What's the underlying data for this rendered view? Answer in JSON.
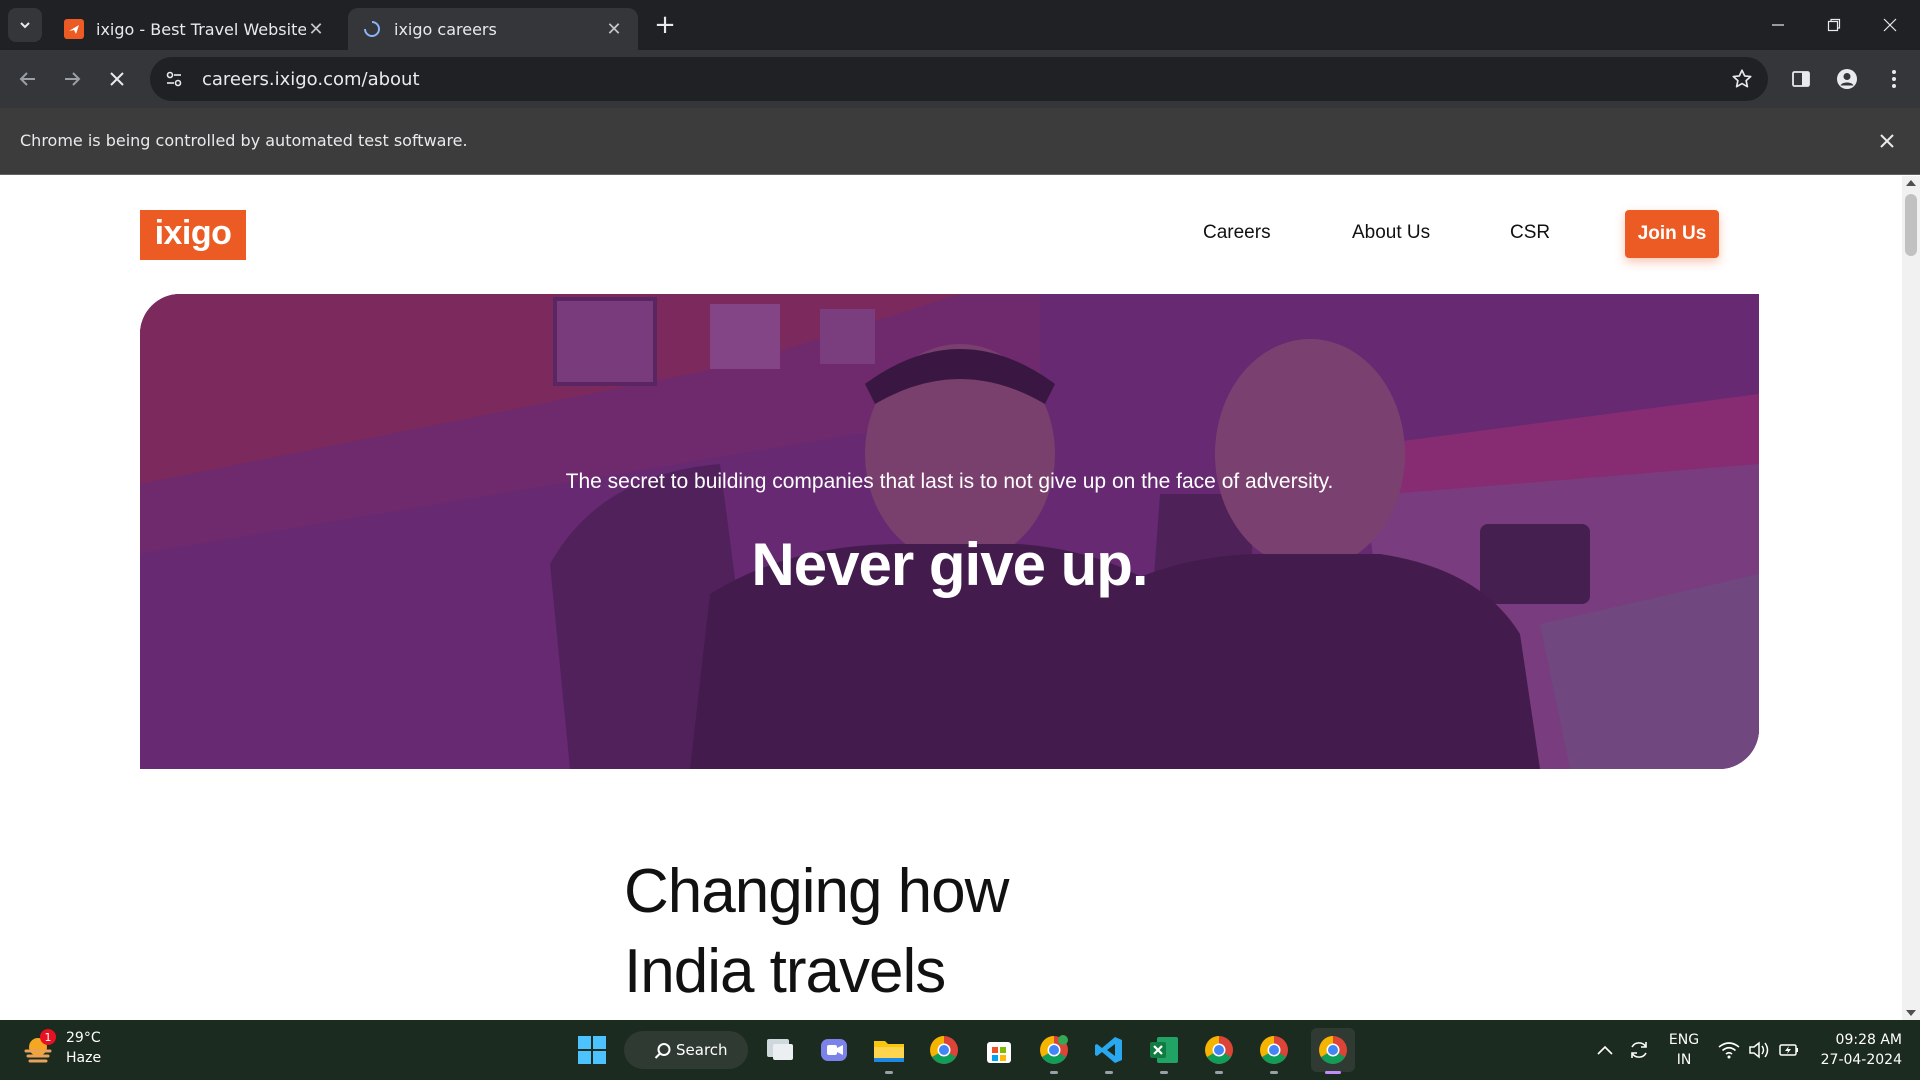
{
  "browser": {
    "tabs": [
      {
        "title": "ixigo - Best Travel Website, Bo",
        "active": false
      },
      {
        "title": "ixigo careers",
        "active": true
      }
    ],
    "url": "careers.ixigo.com/about",
    "infobar_message": "Chrome is being controlled by automated test software."
  },
  "page": {
    "logo_text": "ixigo",
    "nav": {
      "careers": "Careers",
      "about": "About Us",
      "csr": "CSR",
      "join": "Join Us"
    },
    "hero": {
      "subtitle": "The secret to building companies that last is to not give up on the face of adversity.",
      "title": "Never give up."
    },
    "headline_line1": "Changing how",
    "headline_line2": "India travels"
  },
  "taskbar": {
    "weather_temp": "29°C",
    "weather_desc": "Haze",
    "weather_badge": "1",
    "search_label": "Search",
    "lang_top": "ENG",
    "lang_bottom": "IN",
    "time": "09:28 AM",
    "date": "27-04-2024"
  },
  "colors": {
    "brand": "#ec5b24",
    "hero_overlay": "#6c2f76"
  }
}
